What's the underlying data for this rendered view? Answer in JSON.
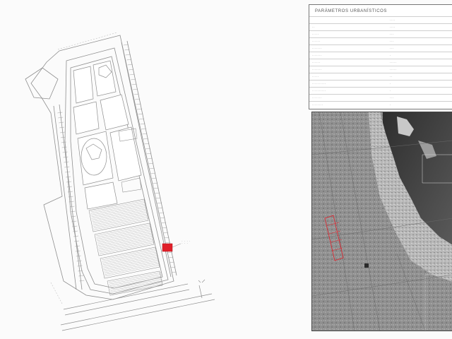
{
  "plan": {
    "callout_lines": [
      "· · · ·",
      "· · ·"
    ],
    "parcel_labels": [
      "·",
      "·",
      "·",
      "·",
      "·",
      "·",
      "·",
      "·",
      "·",
      "·"
    ]
  },
  "params": {
    "title": "PARÁMETROS URBANÍSTICOS",
    "rows": [
      {
        "label": "",
        "value": "·  ·  ·  ·"
      },
      {
        "label": "· ·",
        "value": "· · · ·"
      },
      {
        "label": "· · · · ·",
        "value": "· · ·"
      },
      {
        "label": "· · · · · ·",
        "value": "· · ·"
      },
      {
        "label": "· · · · · · ·",
        "value": "· · ·"
      },
      {
        "label": "· · · · · · ·",
        "value": "·"
      },
      {
        "label": "· · · · · ·",
        "value": "· · · · ·"
      },
      {
        "label": "· · · · · · ·",
        "value": "· · · · ·"
      },
      {
        "label": "· · · · ·",
        "value": "· ·"
      },
      {
        "label": "· · · · · · · · · ·",
        "value": "·"
      },
      {
        "label": "· · · · · · · · · ·",
        "value": "·"
      },
      {
        "label": "· · · · · · ·",
        "value": "· · ·"
      },
      {
        "label": "· · · · · · · ·",
        "value": "·"
      }
    ]
  },
  "colors": {
    "accent_red": "#e0202a",
    "line": "#8a8a8a",
    "aerial_dark": "#4a4a4a",
    "aerial_light": "#b8b8b8"
  }
}
